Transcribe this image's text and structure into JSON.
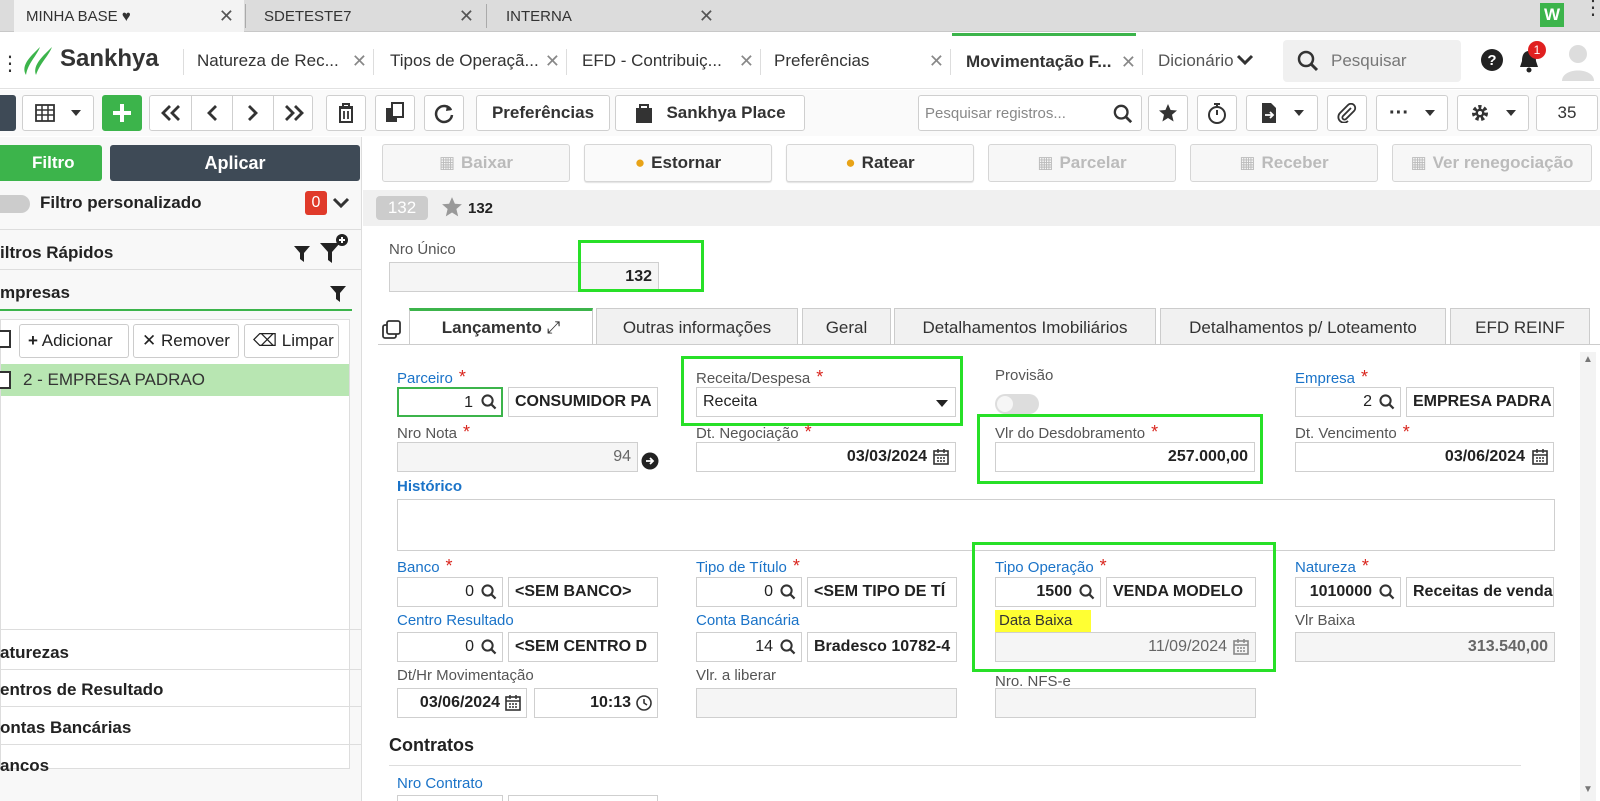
{
  "browser_tabs": [
    {
      "label": "MINHA BASE ♥",
      "active": true
    },
    {
      "label": "SDETESTE7",
      "active": false
    },
    {
      "label": "INTERNA",
      "active": false
    }
  ],
  "browser_badge": "W",
  "app": {
    "logo_text": "Sankhya",
    "tabs": [
      {
        "label": "Natureza de Rec..."
      },
      {
        "label": "Tipos de Operaçã..."
      },
      {
        "label": "EFD - Contribuiç..."
      },
      {
        "label": "Preferências"
      },
      {
        "label": "Movimentação F..."
      },
      {
        "label": "Dicionário"
      }
    ],
    "search_placeholder": "Pesquisar",
    "notification_count": "1"
  },
  "toolbar": {
    "preferences_label": "Preferências",
    "place_label": "Sankhya Place",
    "search_placeholder": "Pesquisar registros...",
    "page_size": "35"
  },
  "actions": {
    "baixar": "Baixar",
    "estornar": "Estornar",
    "ratear": "Ratear",
    "parcelar": "Parcelar",
    "receber": "Receber",
    "ver_renegociacao": "Ver renegociação"
  },
  "sidebar": {
    "filtro_label": "Filtro",
    "apply_label": "Aplicar",
    "custom_filter_label": "Filtro personalizado",
    "custom_filter_count": "0",
    "quick_filters_label": "iltros Rápidos",
    "empresas_label": "mpresas",
    "add_label": "Adicionar",
    "remove_label": "Remover",
    "clear_label": "Limpar",
    "empresa_item": "2 - EMPRESA PADRAO",
    "sections": [
      "aturezas",
      "entros de Resultado",
      "ontas Bancárias",
      "ancos"
    ]
  },
  "record": {
    "badge": "132",
    "title": "132"
  },
  "form": {
    "nro_unico_label": "Nro Único",
    "nro_unico": "132",
    "tabs": [
      "Lançamento",
      "Outras informações",
      "Geral",
      "Detalhamentos Imobiliários",
      "Detalhamentos p/ Loteamento",
      "EFD REINF"
    ],
    "parceiro_label": "Parceiro",
    "parceiro_code": "1",
    "parceiro_name": "CONSUMIDOR PA",
    "receita_despesa_label": "Receita/Despesa",
    "receita_despesa": "Receita",
    "provisao_label": "Provisão",
    "empresa_label": "Empresa",
    "empresa_code": "2",
    "empresa_name": "EMPRESA PADRA",
    "nro_nota_label": "Nro Nota",
    "nro_nota": "94",
    "dt_negociacao_label": "Dt. Negociação",
    "dt_negociacao": "03/03/2024",
    "vlr_desdobramento_label": "Vlr do Desdobramento",
    "vlr_desdobramento": "257.000,00",
    "dt_vencimento_label": "Dt. Vencimento",
    "dt_vencimento": "03/06/2024",
    "historico_label": "Histórico",
    "banco_label": "Banco",
    "banco_code": "0",
    "banco_name": "<SEM BANCO>",
    "tipo_titulo_label": "Tipo de Título",
    "tipo_titulo_code": "0",
    "tipo_titulo_name": "<SEM TIPO DE TÍ",
    "tipo_operacao_label": "Tipo Operação",
    "tipo_operacao_code": "1500",
    "tipo_operacao_name": "VENDA MODELO",
    "natureza_label": "Natureza",
    "natureza_code": "1010000",
    "natureza_name": "Receitas de venda",
    "centro_resultado_label": "Centro Resultado",
    "centro_resultado_code": "0",
    "centro_resultado_name": "<SEM CENTRO D",
    "conta_bancaria_label": "Conta Bancária",
    "conta_bancaria_code": "14",
    "conta_bancaria_name": "Bradesco 10782-4",
    "data_baixa_label": "Data Baixa",
    "data_baixa": "11/09/2024",
    "vlr_baixa_label": "Vlr Baixa",
    "vlr_baixa": "313.540,00",
    "dt_hr_mov_label": "Dt/Hr Movimentação",
    "dt_mov": "03/06/2024",
    "hr_mov": "10:13",
    "vlr_liberar_label": "Vlr. a liberar",
    "nro_nfse_label": "Nro. NFS-e",
    "contratos_label": "Contratos",
    "nro_contrato_label": "Nro Contrato"
  },
  "colors": {
    "green": "#3cb44b",
    "highlight": "#28e028",
    "dark_button": "#3e4a56",
    "link": "#1a73c8",
    "yellow": "#ffff33"
  }
}
